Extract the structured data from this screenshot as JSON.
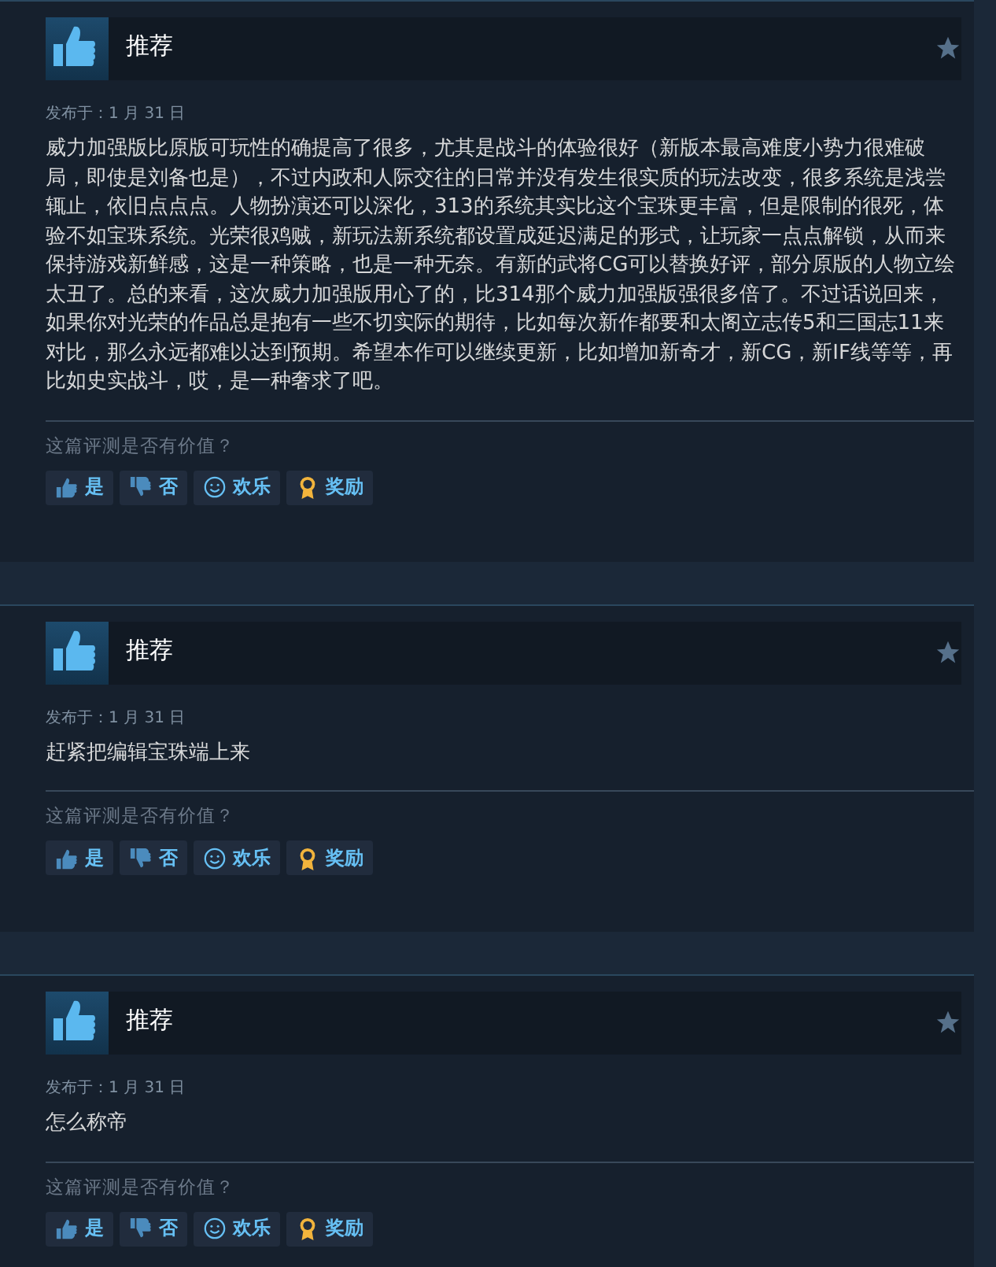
{
  "reviews": [
    {
      "verdict": "推荐",
      "date": "发布于：1 月 31 日",
      "body": "威力加强版比原版可玩性的确提高了很多，尤其是战斗的体验很好（新版本最高难度小势力很难破局，即使是刘备也是），不过内政和人际交往的日常并没有发生很实质的玩法改变，很多系统是浅尝辄止，依旧点点点。人物扮演还可以深化，313的系统其实比这个宝珠更丰富，但是限制的很死，体验不如宝珠系统。光荣很鸡贼，新玩法新系统都设置成延迟满足的形式，让玩家一点点解锁，从而来保持游戏新鲜感，这是一种策略，也是一种无奈。有新的武将CG可以替换好评，部分原版的人物立绘太丑了。总的来看，这次威力加强版用心了的，比314那个威力加强版强很多倍了。不过话说回来，如果你对光荣的作品总是抱有一些不切实际的期待，比如每次新作都要和太阁立志传5和三国志11来对比，那么永远都难以达到预期。希望本作可以继续更新，比如增加新奇才，新CG，新IF线等等，再比如史实战斗，哎，是一种奢求了吧。",
      "question": "这篇评测是否有价值？",
      "buttons": [
        {
          "kind": "yes",
          "label": "是"
        },
        {
          "kind": "no",
          "label": "否"
        },
        {
          "kind": "funny",
          "label": "欢乐"
        },
        {
          "kind": "award",
          "label": "奖励"
        }
      ]
    },
    {
      "verdict": "推荐",
      "date": "发布于：1 月 31 日",
      "body": "赶紧把编辑宝珠端上来",
      "question": "这篇评测是否有价值？",
      "buttons": [
        {
          "kind": "yes",
          "label": "是"
        },
        {
          "kind": "no",
          "label": "否"
        },
        {
          "kind": "funny",
          "label": "欢乐"
        },
        {
          "kind": "award",
          "label": "奖励"
        }
      ]
    },
    {
      "verdict": "推荐",
      "date": "发布于：1 月 31 日",
      "body": "怎么称帝",
      "question": "这篇评测是否有价值？",
      "buttons": [
        {
          "kind": "yes",
          "label": "是"
        },
        {
          "kind": "no",
          "label": "否"
        },
        {
          "kind": "funny",
          "label": "欢乐"
        },
        {
          "kind": "award",
          "label": "奖励"
        }
      ]
    }
  ]
}
